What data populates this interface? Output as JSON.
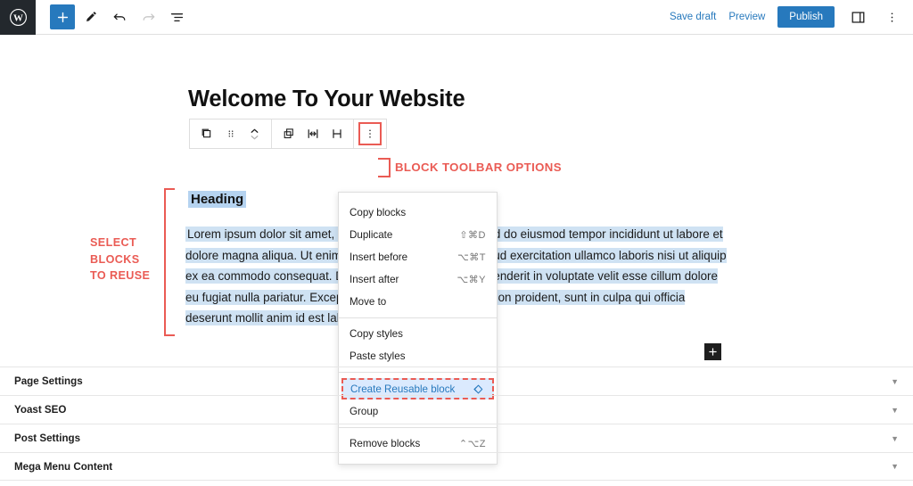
{
  "topbar": {
    "logo_icon": "wordpress-logo-icon",
    "left_tools": [
      {
        "name": "add-block-button",
        "icon": "plus-icon",
        "glyph": "+"
      },
      {
        "name": "edit-tool-button",
        "icon": "pencil-icon",
        "glyph": "✎"
      },
      {
        "name": "undo-button",
        "icon": "undo-arrow-icon",
        "glyph": "↶"
      },
      {
        "name": "redo-button",
        "icon": "redo-arrow-icon",
        "glyph": "↷"
      },
      {
        "name": "list-view-button",
        "icon": "list-view-icon",
        "glyph": "≡"
      }
    ],
    "save_draft": "Save draft",
    "preview": "Preview",
    "publish": "Publish",
    "sidebar_toggle_icon": "settings-sidebar-icon",
    "more_options_icon": "vertical-dots-icon"
  },
  "editor": {
    "page_title": "Welcome To Your Website",
    "heading_block": "Heading",
    "paragraph_parts": [
      "Lorem ipsum dolor sit amet, ",
      "consectetur",
      " adipiscing elit, sed do eiusmod tempor incididunt ut labore et dolore magna aliqua. Ut enim ad minim veniam, quis nostrud exercitation ullamco laboris nisi ut aliquip ex ea commodo consequat. Duis aute irure dolor in reprehenderit in voluptate velit esse cillum dolore eu fugiat nulla pariatur. Excepteur sint occaecat cupidatat non proident, sunt in culpa qui officia deserunt mollit anim id est laborum"
    ],
    "paragraph_text": "Lorem ipsum dolor sit amet, consectetur adipiscing elit, sed do eiusmod tempor incididunt ut labore et dolore magna aliqua. Ut enim ad minim veniam, quis nostrud exercitation ullamco laboris nisi ut aliquip ex ea commodo consequat. Duis aute irure dolor in reprehenderit in voluptate velit esse cillum dolore eu fugiat nulla pariatur. Excepteur sint occaecat cupidatat non proident, sunt in culpa qui officia deserunt mollit anim id est laborum",
    "block_appender_glyph": "+"
  },
  "block_toolbar": {
    "group1": [
      {
        "name": "block-type-icon",
        "glyph": "❐"
      },
      {
        "name": "drag-handle-icon",
        "glyph": "⁙"
      },
      {
        "name": "move-up-down-icon",
        "glyph": "⌃⌄"
      }
    ],
    "group2": [
      {
        "name": "duplicate-blocks-icon",
        "glyph": "⧉"
      },
      {
        "name": "align-center-icon",
        "glyph": "⌶"
      },
      {
        "name": "align-justify-icon",
        "glyph": "⧖"
      }
    ],
    "more_options_icon": "vertical-dots-icon",
    "more_options_glyph": "⋮"
  },
  "menu": {
    "sections": [
      {
        "items": [
          {
            "label": "Copy blocks",
            "shortcut": ""
          },
          {
            "label": "Duplicate",
            "shortcut": "⇧⌘D"
          },
          {
            "label": "Insert before",
            "shortcut": "⌥⌘T"
          },
          {
            "label": "Insert after",
            "shortcut": "⌥⌘Y"
          },
          {
            "label": "Move to",
            "shortcut": ""
          }
        ]
      },
      {
        "items": [
          {
            "label": "Copy styles",
            "shortcut": ""
          },
          {
            "label": "Paste styles",
            "shortcut": ""
          }
        ]
      },
      {
        "items": [
          {
            "label": "Create Reusable block",
            "shortcut": "",
            "highlighted": true,
            "icon": "reusable-block-diamond-icon",
            "icon_glyph": "◈"
          },
          {
            "label": "Group",
            "shortcut": ""
          }
        ]
      },
      {
        "items": [
          {
            "label": "Remove blocks",
            "shortcut": "⌃⌥Z"
          }
        ]
      }
    ]
  },
  "annotations": {
    "toolbar_label": "BLOCK TOOLBAR OPTIONS",
    "select_label_line1": "SELECT",
    "select_label_line2": "BLOCKS",
    "select_label_line3": "TO REUSE",
    "accent_color": "#ea5b54"
  },
  "panels": [
    {
      "label": "Page Settings",
      "chevron": "▼"
    },
    {
      "label": "Yoast SEO",
      "chevron": "▼"
    },
    {
      "label": "Post Settings",
      "chevron": "▼"
    },
    {
      "label": "Mega Menu Content",
      "chevron": "▼"
    }
  ],
  "colors": {
    "accent_blue": "#2779bd",
    "annotation_red": "#ea5b54",
    "selection_blue": "#cfe2f3",
    "dark": "#23282d"
  }
}
